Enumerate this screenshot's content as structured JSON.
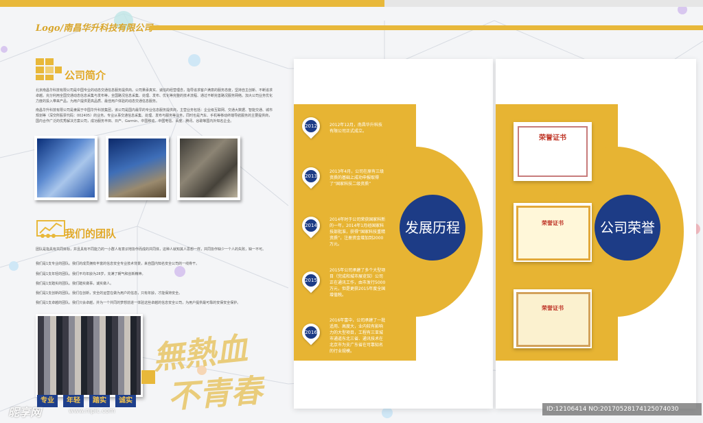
{
  "header": {
    "logo_text": "Logo/南昌华升科技有限公司",
    "brand_color": "#e8b83a"
  },
  "intro": {
    "title": "公司简介",
    "paragraph1": "北京南昌华科技有限公司是中国专业的动态交通信息服务提供商。公司秉承真实、诚信的经营理念，指导追求客户满意的服务态度，坚持自主创新、不断追求卓越。充分利用全国交通动态信息采集与发布等，全国路况信息采集、处理、发布、优化等完整的技术流程、通过不断完善路况服务网络。加大公司业务优化力度的投入带来产品，为用户提供更高品质、最佳用户体验的动态交通信息服务。",
    "paragraph2": "南昌华升科技有限公司是隶属于中国华升科技集团，该公司是国内最早的专业信息服务提供商，主营业务包括：企业级互联网、交通大数据、智能交通、城市规划等（深交所股票代码：002405）的业务。专业从事交通信息采集、处理、发布与服务等业务，同时也是汽车、手机等移动终端导航服务的主要提供商，国内合作广泛的优秀解决方案公司，成功服务丰田、日产、Garmin、中国移动、中国电信、百度、腾讯、谷歌等国内外知名企业。",
    "photo_icons": [
      "photo-1",
      "photo-2",
      "photo-3"
    ]
  },
  "team": {
    "title": "我们的团队",
    "paragraph": "团队是指具有共同目标，并且具有不同能力的一小群人有意识地协作而成的共同体，这种人就知其人思想一样，共同协作缺少一个人的失败，缺一不可。",
    "items": [
      "我们是1支专业的团队。我们的成员拥有丰富的信息安全专业技术背景，来自国内知名安全公司的一线骨干。",
      "我们是1支年轻的团队。我们平均年龄为28岁，充满了朝气和创新精神。",
      "我们是1支踏实的团队。我们踏实做事，诚实做人。",
      "我们是1支创新的团队。我们在创新，安全的运营在做为用户的信息，只有年龄，才能保持安全。",
      "我们是1支卓越的团队。我们只会卓越，并为一个共同的梦想前进一体验这些卓越的信息安全公司，为用户提供最可靠的安保安全保护。"
    ],
    "tags": [
      "专业",
      "年轻",
      "踏实",
      "诚实"
    ]
  },
  "slogan": {
    "line1": "無熱血",
    "line2": "不青春"
  },
  "history": {
    "title": "发展历程",
    "events": [
      {
        "year": "2012",
        "text": "2012年12月，南昌华升科技有限公司正式成立。"
      },
      {
        "year": "2013",
        "text": "2013年4月，公司在原有三级资质的基础上成功申报取得了“国家科技二级资质”"
      },
      {
        "year": "2014",
        "text": "2014年时于公司荣获国家科新的一年，2014年1月经国家科技部批准，获得“国家科技重精资质”，注册资金增加到2000万元。"
      },
      {
        "year": "2015",
        "text": "2015年公司承建了多个大型项目（完成和城市展览馆）公司正在通讯工作，由市发行5000万元，但是更获2015年度全国增值税。"
      },
      {
        "year": "2016",
        "text": "2016年富中，公司承建了一批适用、高度大，业内较有影响力的大型项目，工程有三亚城市通道东北三省、通讯技术在北京市为支广东省在可靠知名的行业规模。"
      }
    ]
  },
  "honors": {
    "title": "公司荣誉",
    "certificates": [
      "荣誉证书",
      "荣誉证书",
      "荣誉证书"
    ]
  },
  "watermark": {
    "brand": "昵享网",
    "url": "www.nipic.com",
    "id_text": "ID:12106414 NO:20170528174125074030"
  }
}
